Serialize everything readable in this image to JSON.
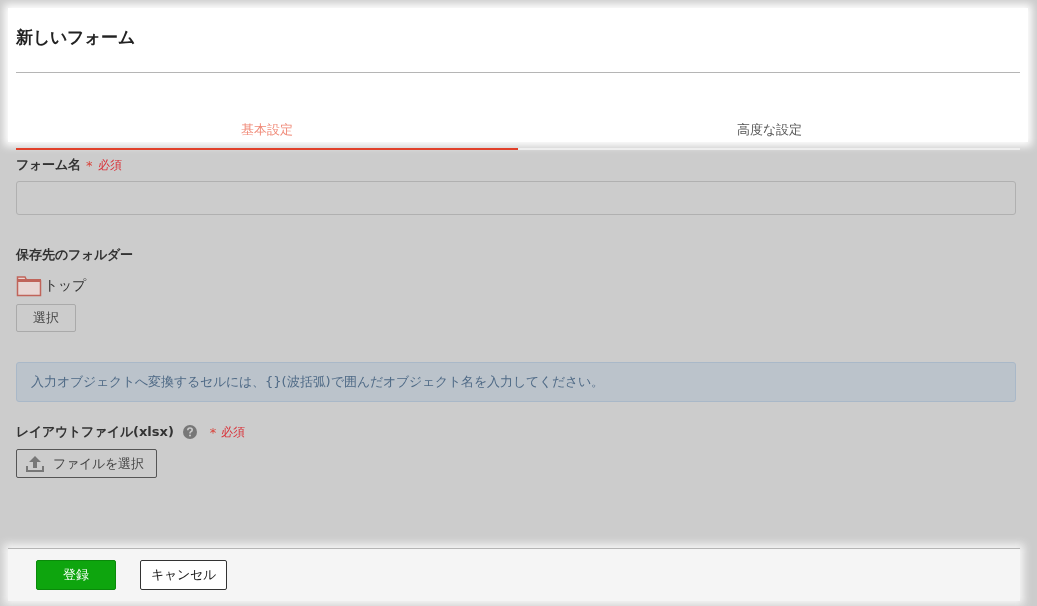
{
  "title": "新しいフォーム",
  "tabs": [
    {
      "label": "基本設定",
      "selected": true
    },
    {
      "label": "高度な設定",
      "selected": false
    }
  ],
  "form_name": {
    "label": "フォーム名",
    "required_mark": "*",
    "required_text": "必須"
  },
  "folder": {
    "label": "保存先のフォルダー",
    "current": "トップ",
    "select_button": "選択"
  },
  "notice": "入力オブジェクトへ変換するセルには、{}(波括弧)で囲んだオブジェクト名を入力してください。",
  "layout_file": {
    "label": "レイアウトファイル(xlsx)",
    "required_mark": "*",
    "required_text": "必須",
    "file_button": "ファイルを選択"
  },
  "footer": {
    "submit": "登録",
    "cancel": "キャンセル"
  }
}
